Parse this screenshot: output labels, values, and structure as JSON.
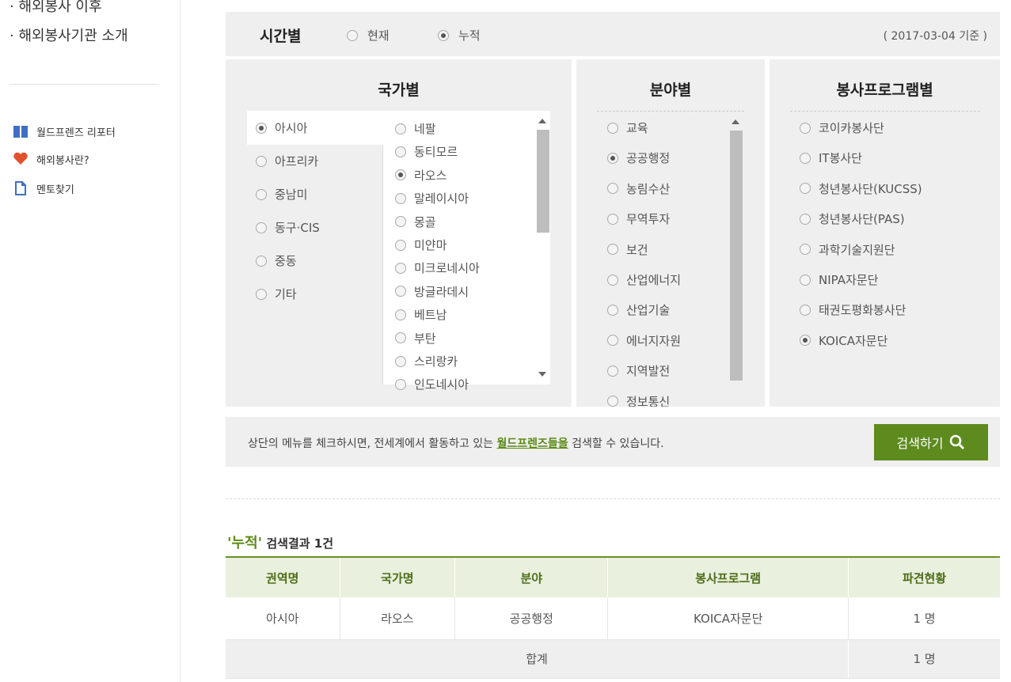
{
  "sidebar": {
    "links": [
      "· 해외봉사 이후",
      "· 해외봉사기관 소개"
    ],
    "quick": [
      {
        "label": "월드프렌즈 리포터",
        "icon": "book-icon",
        "color": "#3e6fc4"
      },
      {
        "label": "해외봉사란?",
        "icon": "heart-icon",
        "color": "#e0522b"
      },
      {
        "label": "멘토찾기",
        "icon": "document-icon",
        "color": "#3e6fc4"
      }
    ]
  },
  "time": {
    "title": "시간별",
    "options": [
      {
        "label": "현재",
        "selected": false
      },
      {
        "label": "누적",
        "selected": true
      }
    ],
    "date": "( 2017-03-04 기준 )"
  },
  "country": {
    "title": "국가별",
    "regions": [
      {
        "label": "아시아",
        "selected": true
      },
      {
        "label": "아프리카",
        "selected": false
      },
      {
        "label": "중남미",
        "selected": false
      },
      {
        "label": "동구·CIS",
        "selected": false
      },
      {
        "label": "중동",
        "selected": false
      },
      {
        "label": "기타",
        "selected": false
      }
    ],
    "countries": [
      {
        "label": "네팔",
        "selected": false
      },
      {
        "label": "동티모르",
        "selected": false
      },
      {
        "label": "라오스",
        "selected": true
      },
      {
        "label": "말레이시아",
        "selected": false
      },
      {
        "label": "몽골",
        "selected": false
      },
      {
        "label": "미얀마",
        "selected": false
      },
      {
        "label": "미크로네시아",
        "selected": false
      },
      {
        "label": "방글라데시",
        "selected": false
      },
      {
        "label": "베트남",
        "selected": false
      },
      {
        "label": "부탄",
        "selected": false
      },
      {
        "label": "스리랑카",
        "selected": false
      },
      {
        "label": "인도네시아",
        "selected": false
      }
    ]
  },
  "field": {
    "title": "분야별",
    "items": [
      {
        "label": "교육",
        "selected": false
      },
      {
        "label": "공공행정",
        "selected": true
      },
      {
        "label": "농림수산",
        "selected": false
      },
      {
        "label": "무역투자",
        "selected": false
      },
      {
        "label": "보건",
        "selected": false
      },
      {
        "label": "산업에너지",
        "selected": false
      },
      {
        "label": "산업기술",
        "selected": false
      },
      {
        "label": "에너지자원",
        "selected": false
      },
      {
        "label": "지역발전",
        "selected": false
      },
      {
        "label": "정보통신",
        "selected": false
      }
    ]
  },
  "program": {
    "title": "봉사프로그램별",
    "items": [
      {
        "label": "코이카봉사단",
        "selected": false
      },
      {
        "label": "IT봉사단",
        "selected": false
      },
      {
        "label": "청년봉사단(KUCSS)",
        "selected": false
      },
      {
        "label": "청년봉사단(PAS)",
        "selected": false
      },
      {
        "label": "과학기술지원단",
        "selected": false
      },
      {
        "label": "NIPA자문단",
        "selected": false
      },
      {
        "label": "태권도평화봉사단",
        "selected": false
      },
      {
        "label": "KOICA자문단",
        "selected": true
      }
    ]
  },
  "info": {
    "before": "상단의 메뉴를 체크하시면, 전세계에서 활동하고 있는 ",
    "highlight": "월드프렌즈들을",
    "after": " 검색할 수 있습니다.",
    "button": "검색하기"
  },
  "results": {
    "quote": "'누적'",
    "suffix": " 검색결과 1건",
    "headers": [
      "권역명",
      "국가명",
      "분야",
      "봉사프로그램",
      "파견현황"
    ],
    "rows": [
      [
        "아시아",
        "라오스",
        "공공행정",
        "KOICA자문단",
        "1 명"
      ]
    ],
    "total_label": "합계",
    "total_value": "1 명"
  },
  "colors": {
    "accent": "#5e8b1e",
    "panel_bg": "#efefef",
    "header_bg": "#e9f0dd"
  }
}
